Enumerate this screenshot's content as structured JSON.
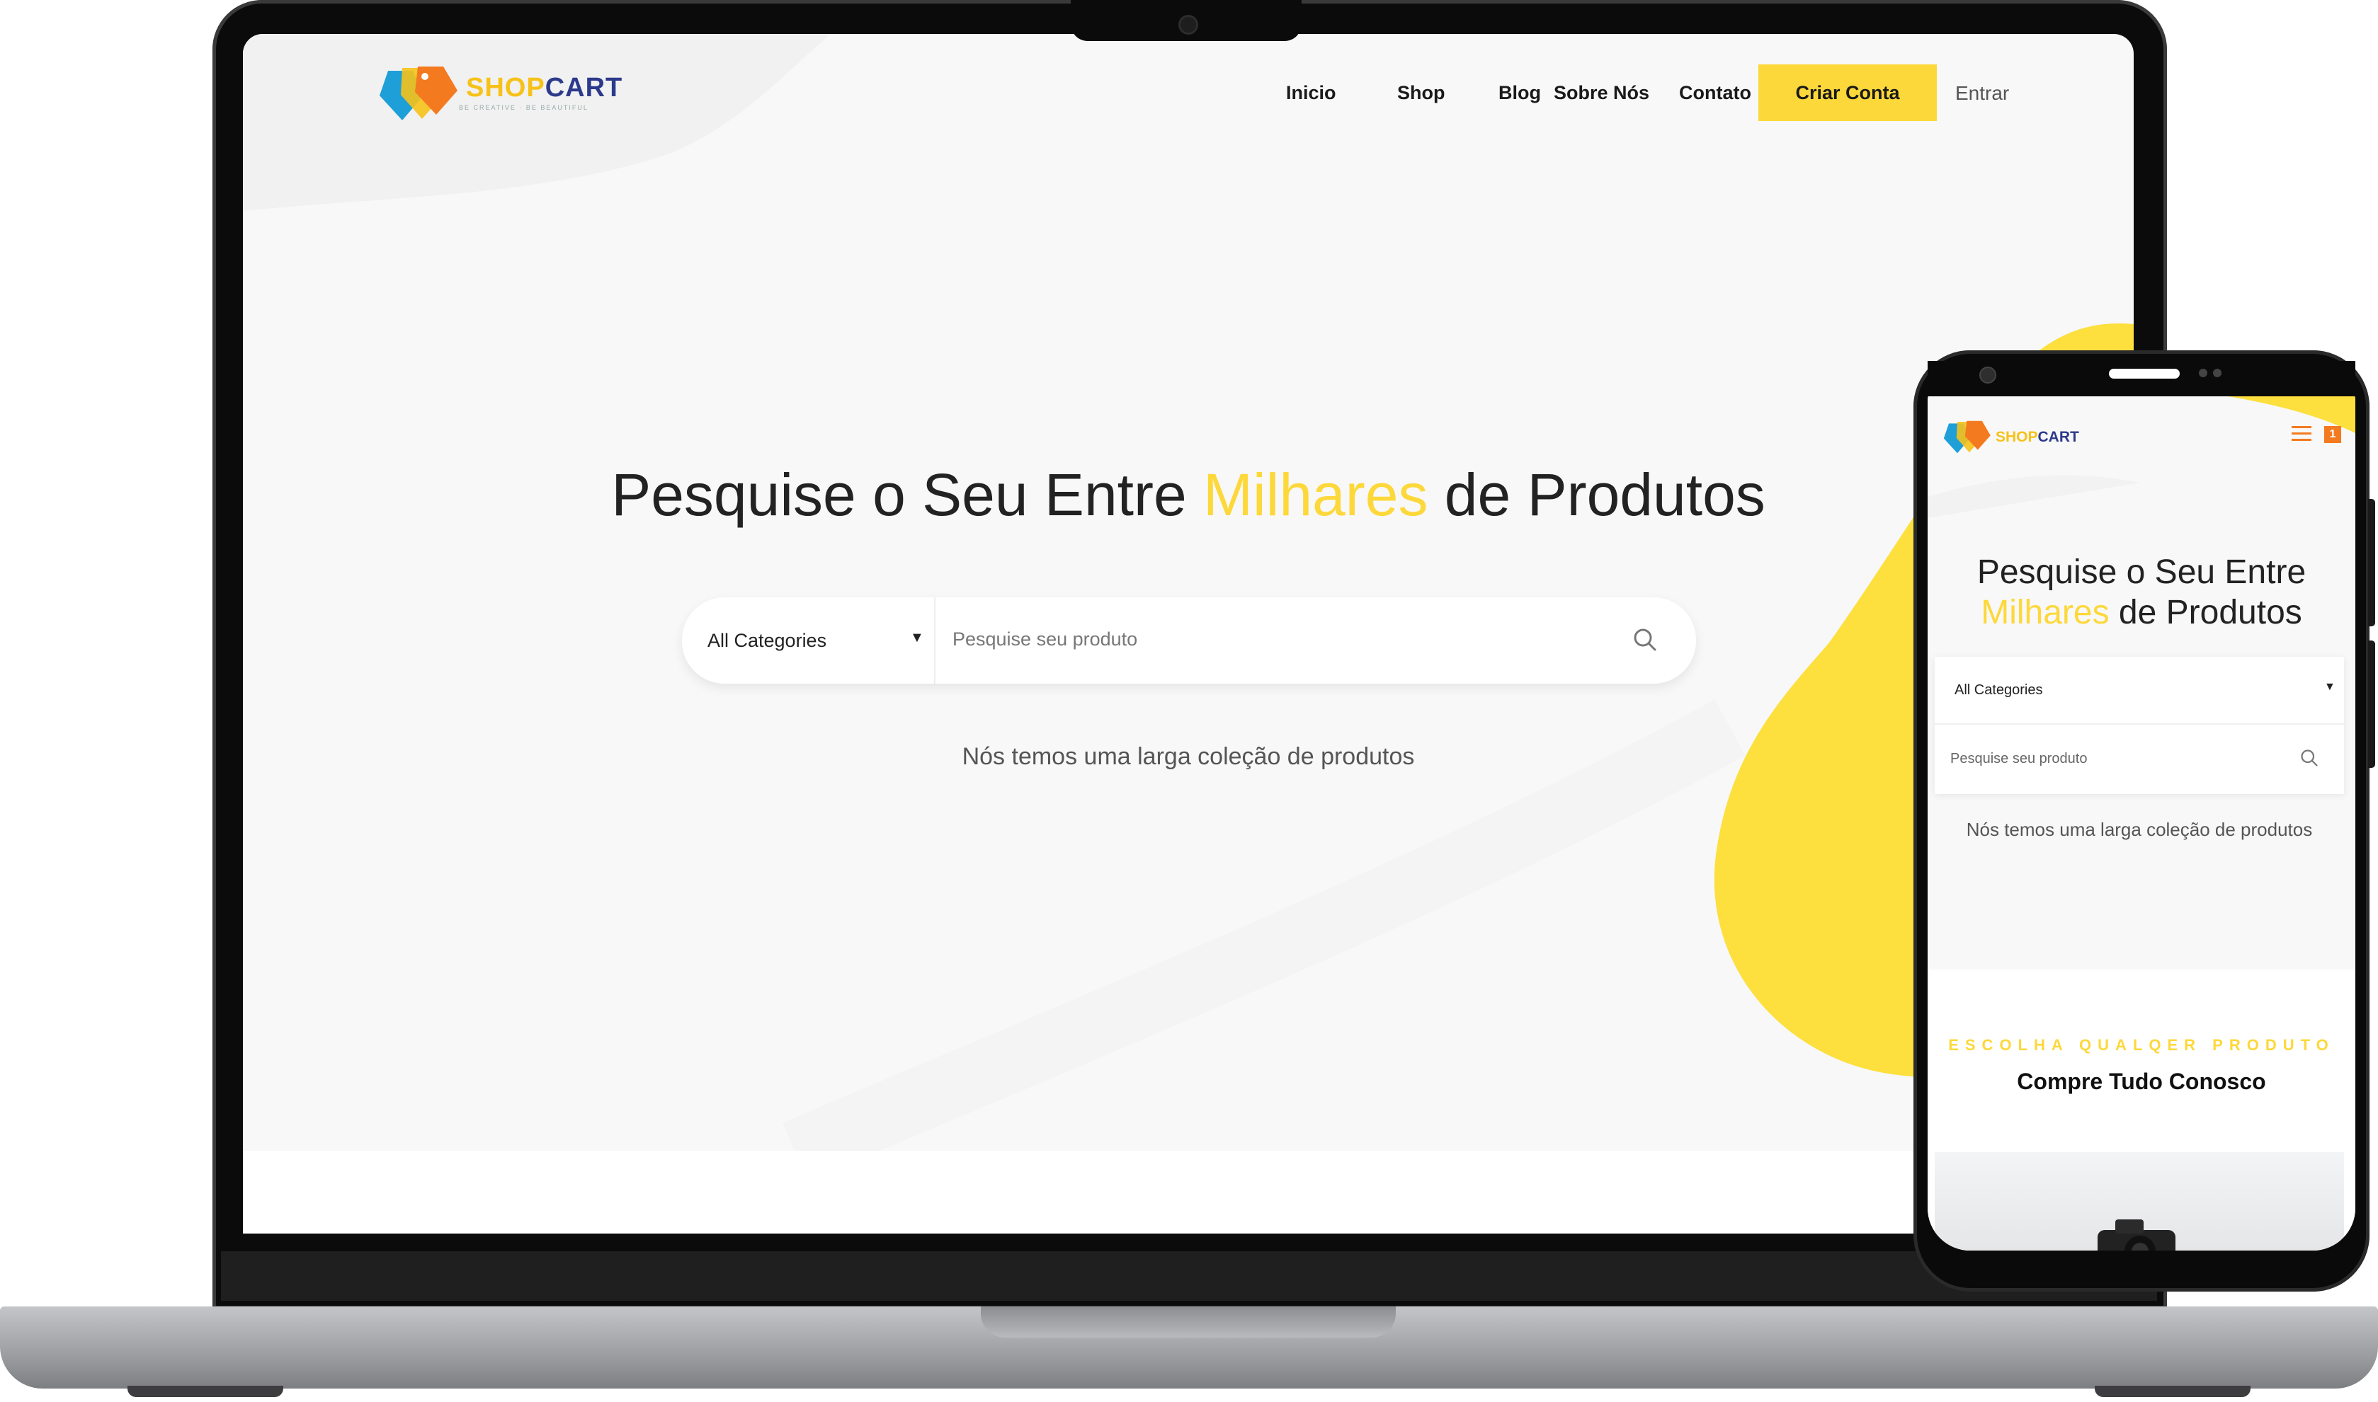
{
  "brand": {
    "name_part1": "SHOP",
    "name_part2": "CART",
    "tagline": "BE CREATIVE · BE BEAUTIFUL",
    "accent_color": "#fdd83a",
    "brand_blue": "#2c3a8c",
    "brand_orange": "#f47a20"
  },
  "nav": {
    "items": [
      {
        "label": "Inicio"
      },
      {
        "label": "Shop"
      },
      {
        "label": "Blog"
      },
      {
        "label": "Sobre Nós"
      },
      {
        "label": "Contato"
      }
    ],
    "cta_label": "Criar Conta",
    "login_label": "Entrar"
  },
  "hero": {
    "title_part1": "Pesquise o Seu Entre ",
    "title_accent": "Milhares",
    "title_part2": " de Produtos",
    "subtitle": "Nós temos uma larga coleção de produtos"
  },
  "search": {
    "category_selected": "All Categories",
    "placeholder": "Pesquise seu produto"
  },
  "mobile": {
    "title_part1": "Pesquise o Seu Entre ",
    "title_accent": "Milhares",
    "title_part2": " de Produtos",
    "category_selected": "All Categories",
    "placeholder": "Pesquise seu produto",
    "subtitle": "Nós temos uma larga coleção de produtos",
    "badge": "1",
    "section_eyebrow": "ESCOLHA QUALQER PRODUTO",
    "section_heading": "Compre Tudo Conosco"
  },
  "icons": {
    "search": "search-icon",
    "menu": "hamburger-menu-icon",
    "chevron": "chevron-down-icon"
  }
}
